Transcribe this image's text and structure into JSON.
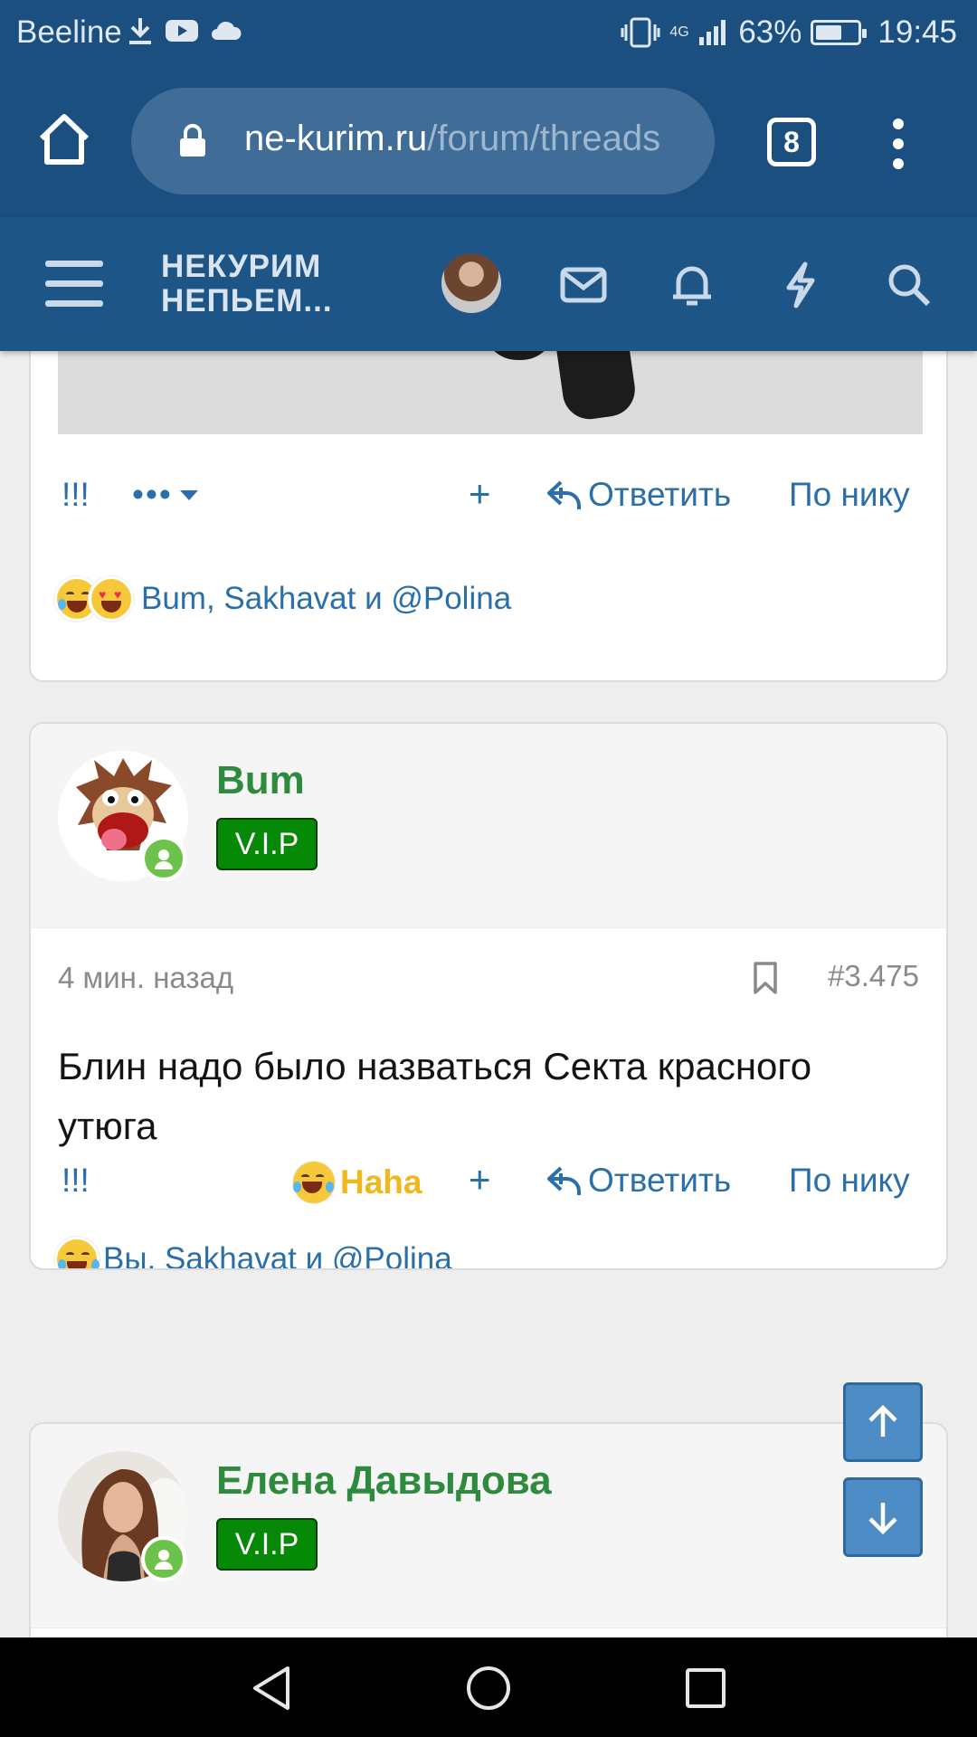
{
  "status_bar": {
    "carrier": "Beeline",
    "network": "4G",
    "battery_percent": "63%",
    "battery_level": 0.63,
    "time": "19:45"
  },
  "browser": {
    "url_domain": "ne-kurim.ru",
    "url_path": "/forum/threads",
    "tab_count": "8"
  },
  "site_header": {
    "logo_line1": "НЕКУРИМ",
    "logo_line2": "НЕПЬЕМ..."
  },
  "posts": [
    {
      "actions": {
        "exclaim": "!!!",
        "more": "•••",
        "plus": "+",
        "reply": "Ответить",
        "by_nick": "По нику"
      },
      "reactions_text": "Bum, Sakhavat и @Polina"
    },
    {
      "username": "Bum",
      "badge": "V.I.P",
      "time": "4 мин. назад",
      "post_number": "#3.475",
      "text": "Блин надо было назваться Секта красного утюга",
      "actions": {
        "exclaim": "!!!",
        "reaction_label": "Haha",
        "plus": "+",
        "reply": "Ответить",
        "by_nick": "По нику"
      },
      "reactions_text": "Вы, Sakhavat и @Polina"
    },
    {
      "username": "Елена Давыдова",
      "badge": "V.I.P"
    }
  ],
  "colors": {
    "header_blue": "#1d5587",
    "link_blue": "#2a6fa9",
    "username_green": "#2e8b3e",
    "vip_green": "#068906",
    "haha_yellow": "#f0b81f"
  }
}
